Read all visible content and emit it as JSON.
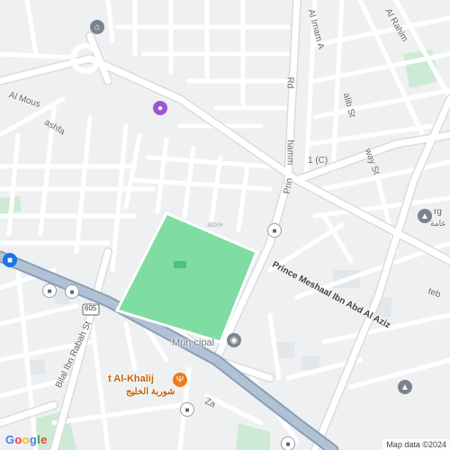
{
  "labels": {
    "al_imam": "Al Imam A",
    "al_rahim": "Al Rahim",
    "al_mous": "Al Mous",
    "ashfa": "ashfa",
    "rd": "Rd",
    "hamm": "hamm",
    "prin": "Prin",
    "alib_st": "alib St",
    "way_st": "way St",
    "one_c": "1 (C)",
    "prince_meshaal": "Prince Meshaal Ibn Abd Al Aziz",
    "municipal": "Mun cipal",
    "bilal": "Bilal Ibn Rabah St",
    "al_khalij": "t Al-Khalij",
    "al_khalij_ar": "شوربة الخليج",
    "za": "Za",
    "rg": "rg",
    "ar_amma": "عامة",
    "teb": "teb",
    "route_605": "605",
    "store": "store"
  },
  "icons": {
    "museum": "museum-icon",
    "shopping": "shopping-icon",
    "mosque": "mosque-icon",
    "restaurant": "restaurant-icon",
    "bus": "bus-icon",
    "government": "government-icon",
    "lock": "lock-icon"
  },
  "colors": {
    "background": "#f1f3f4",
    "road": "#ffffff",
    "road_casing": "#dadce0",
    "highway": "#a5b6c9",
    "park": "#7fdca2",
    "park_dark": "#4fc17e",
    "green_area": "#cdebd4",
    "poi_purple": "#9e56d3",
    "poi_orange": "#ef7b1e",
    "poi_grey": "#7b848e",
    "poi_blue": "#1a73e8"
  },
  "logo": "Google",
  "attribution": "Map data ©2024"
}
